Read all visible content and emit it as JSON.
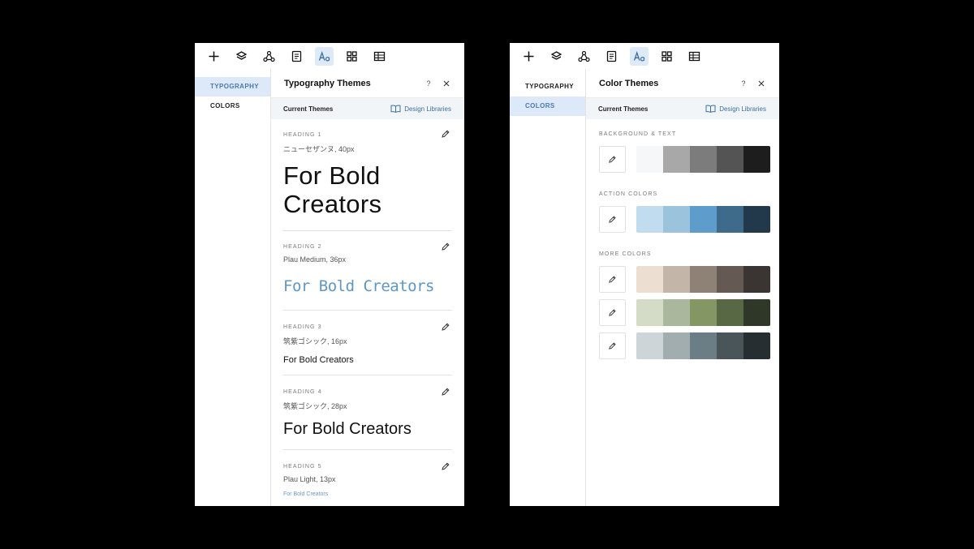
{
  "toolbar_icons": [
    "add-icon",
    "layers-icon",
    "connect-icon",
    "page-icon",
    "typography-icon",
    "apps-grid-icon",
    "table-icon"
  ],
  "sidebar": {
    "items": [
      "TYPOGRAPHY",
      "COLORS"
    ]
  },
  "typography_panel": {
    "title": "Typography Themes",
    "help_label": "?",
    "current_themes": "Current Themes",
    "design_libraries": "Design Libraries",
    "headings": [
      {
        "label": "HEADING 1",
        "spec": "ニューセザンヌ, 40px",
        "sample": "For Bold Creators"
      },
      {
        "label": "HEADING 2",
        "spec": "Plau Medium, 36px",
        "sample": "For Bold Creators"
      },
      {
        "label": "HEADING 3",
        "spec": "筑紫ゴシック, 16px",
        "sample": "For Bold Creators"
      },
      {
        "label": "HEADING 4",
        "spec": "筑紫ゴシック, 28px",
        "sample": "For Bold Creators"
      },
      {
        "label": "HEADING 5",
        "spec": "Plau Light, 13px",
        "sample": "For Bold Creators"
      }
    ]
  },
  "color_panel": {
    "title": "Color Themes",
    "help_label": "?",
    "current_themes": "Current Themes",
    "design_libraries": "Design Libraries",
    "sections": [
      {
        "label": "BACKGROUND & TEXT",
        "palettes": [
          [
            "#f6f7f8",
            "#a8a8a8",
            "#7c7c7c",
            "#545454",
            "#1d1d1d"
          ]
        ]
      },
      {
        "label": "ACTION COLORS",
        "palettes": [
          [
            "#c1dcef",
            "#9cc3dc",
            "#5d9ccb",
            "#3e6b89",
            "#21394a"
          ]
        ]
      },
      {
        "label": "MORE COLORS",
        "palettes": [
          [
            "#ecdfd2",
            "#c3b5a8",
            "#8e8277",
            "#645a53",
            "#3a3433"
          ],
          [
            "#d4dcc8",
            "#aab79c",
            "#849664",
            "#596844",
            "#2f3828"
          ],
          [
            "#ced5d9",
            "#a2adb0",
            "#6b7e86",
            "#4a555a",
            "#272e31"
          ]
        ]
      }
    ]
  },
  "colors": {
    "accent": "#4a79ad",
    "active_bg": "#dde9f9",
    "link": "#3c6f9f"
  }
}
